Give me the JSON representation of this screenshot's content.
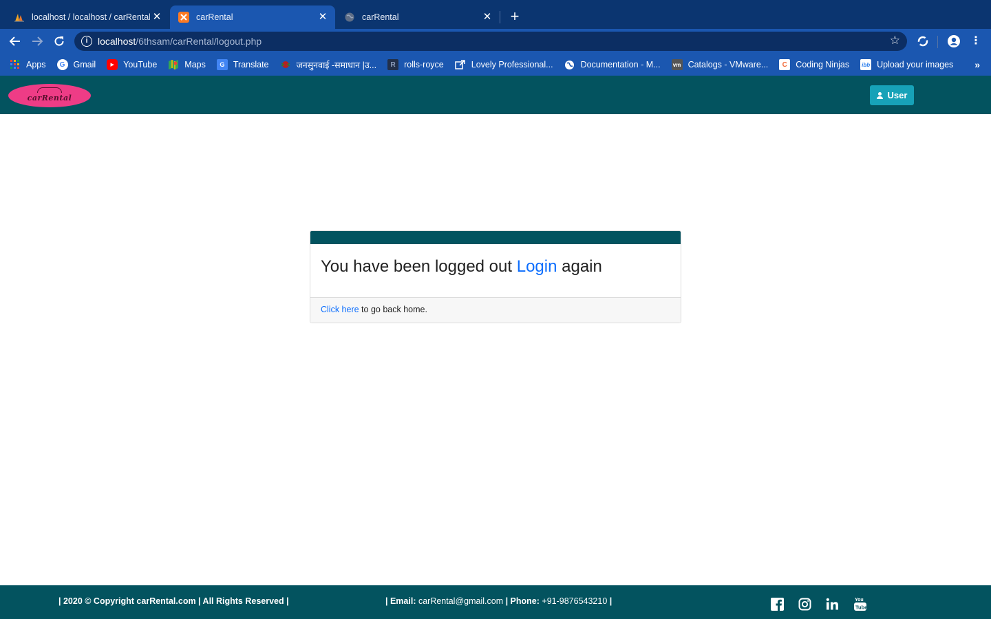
{
  "browser": {
    "tabs": [
      {
        "title": "localhost / localhost / carRental / ",
        "favicon": "phpmyadmin-sail-icon"
      },
      {
        "title": "carRental",
        "favicon": "xampp-icon"
      },
      {
        "title": "carRental",
        "favicon": "globe-icon"
      }
    ],
    "url_host": "localhost",
    "url_path": "/6thsam/carRental/logout.php",
    "bookmarks": [
      {
        "label": "Apps",
        "icon": "apps-grid-icon",
        "color": "#e8453c"
      },
      {
        "label": "Gmail",
        "icon": "google-icon",
        "color": "#ffffff"
      },
      {
        "label": "YouTube",
        "icon": "youtube-icon",
        "color": "#ff0000"
      },
      {
        "label": "Maps",
        "icon": "maps-icon",
        "color": "#34a853"
      },
      {
        "label": "Translate",
        "icon": "translate-icon",
        "color": "#4285f4"
      },
      {
        "label": "जनसुनवाई -समाधान |उ...",
        "icon": "emblem-icon",
        "color": "#b22222"
      },
      {
        "label": "rolls-royce",
        "icon": "rolls-royce-icon",
        "color": "#22304a"
      },
      {
        "label": "Lovely Professional...",
        "icon": "external-link-icon",
        "color": "#1b57b0"
      },
      {
        "label": "Documentation - M...",
        "icon": "globe-icon",
        "color": "#ffffff"
      },
      {
        "label": "Catalogs - VMware...",
        "icon": "vmware-icon",
        "color": "#555555"
      },
      {
        "label": "Coding Ninjas",
        "icon": "coding-ninjas-icon",
        "color": "#f26b3a"
      },
      {
        "label": "Upload your images",
        "icon": "ibb-icon",
        "color": "#2f80ed"
      }
    ]
  },
  "header": {
    "logo_text": "carRental",
    "user_button": "User"
  },
  "card": {
    "message_before": "You have been logged out ",
    "login_link": "Login",
    "message_after": " again",
    "footer_link": "Click here",
    "footer_text": " to go back home."
  },
  "footer": {
    "copyright": "| 2020 © Copyright carRental.com | All Rights Reserved |",
    "email_label": "| Email:",
    "email": " carRental@gmail.com",
    "phone_label": " | Phone:",
    "phone": " +91-9876543210",
    "end": " |",
    "social": [
      "facebook-icon",
      "instagram-icon",
      "linkedin-icon",
      "youtube-icon"
    ]
  },
  "colors": {
    "header_bg": "#03535f",
    "user_button_bg": "#17a2b8",
    "link": "#0d6efd",
    "chrome_bg": "#1b57b0"
  }
}
